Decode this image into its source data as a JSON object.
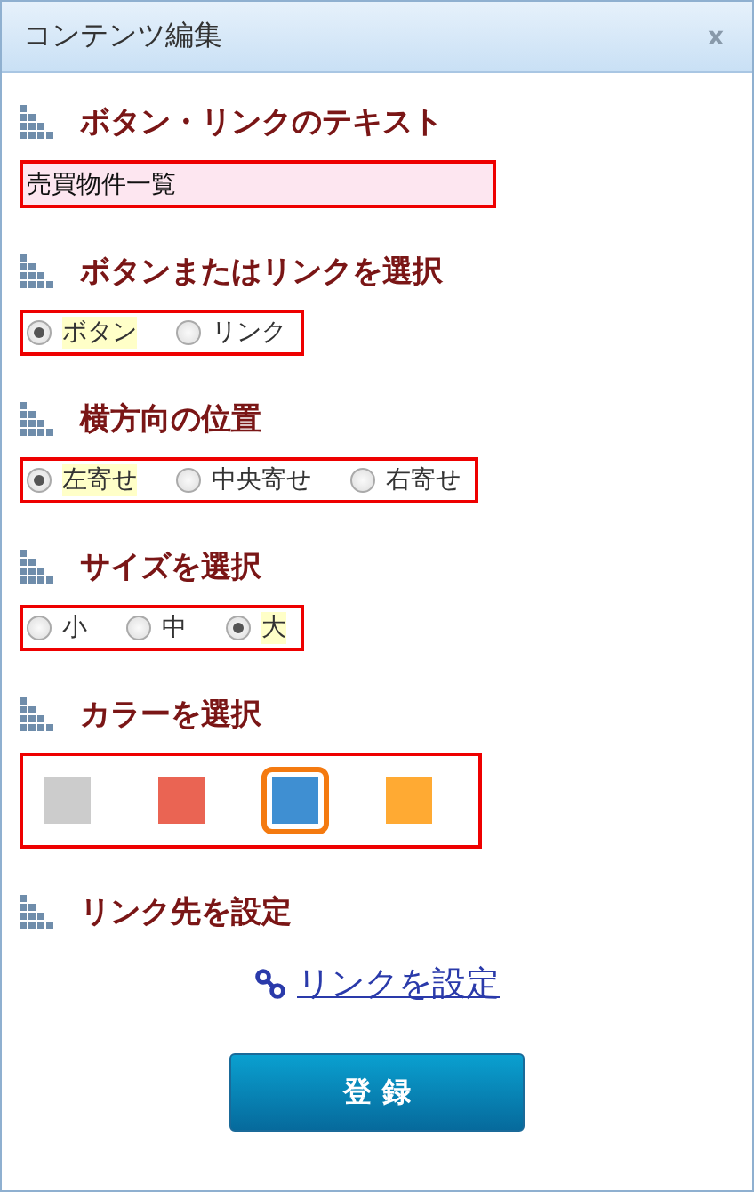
{
  "window": {
    "title": "コンテンツ編集",
    "close": "x"
  },
  "sections": [
    {
      "kind": "text",
      "heading": "ボタン・リンクのテキスト",
      "value": "売買物件一覧"
    },
    {
      "kind": "radio",
      "heading": "ボタンまたはリンクを選択",
      "options": [
        {
          "label": "ボタン",
          "selected": true
        },
        {
          "label": "リンク",
          "selected": false
        }
      ]
    },
    {
      "kind": "radio",
      "heading": "横方向の位置",
      "options": [
        {
          "label": "左寄せ",
          "selected": true
        },
        {
          "label": "中央寄せ",
          "selected": false
        },
        {
          "label": "右寄せ",
          "selected": false
        }
      ]
    },
    {
      "kind": "radio",
      "heading": "サイズを選択",
      "options": [
        {
          "label": "小",
          "selected": false
        },
        {
          "label": "中",
          "selected": false
        },
        {
          "label": "大",
          "selected": true
        }
      ]
    },
    {
      "kind": "color",
      "heading": "カラーを選択",
      "swatches": [
        {
          "color": "#cccccc",
          "selected": false
        },
        {
          "color": "#ea6453",
          "selected": false
        },
        {
          "color": "#3f8fd2",
          "selected": true
        },
        {
          "color": "#ffaa33",
          "selected": false
        }
      ]
    },
    {
      "kind": "link",
      "heading": "リンク先を設定",
      "link": "リンクを設定"
    }
  ],
  "submit": "登 録"
}
